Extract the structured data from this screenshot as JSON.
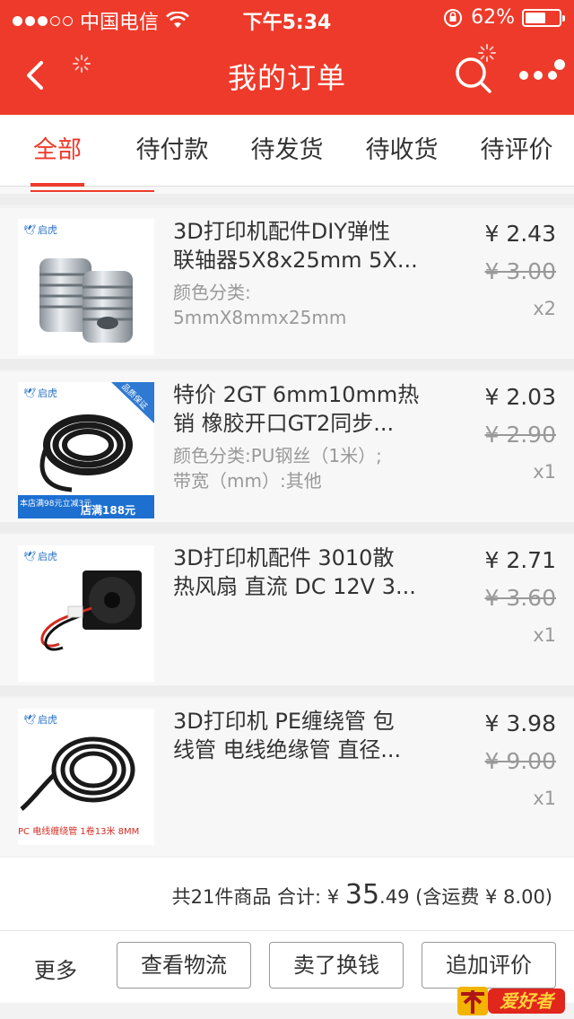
{
  "status": {
    "carrier": "中国电信",
    "time": "下午5:34",
    "battery_pct": "62%",
    "battery_level": 0.62,
    "signal_dots_filled": 3
  },
  "nav": {
    "title": "我的订单"
  },
  "tabs": [
    {
      "label": "全部",
      "active": true
    },
    {
      "label": "待付款",
      "active": false
    },
    {
      "label": "待发货",
      "active": false
    },
    {
      "label": "待收货",
      "active": false
    },
    {
      "label": "待评价",
      "active": false
    }
  ],
  "items": [
    {
      "brand": "启虎",
      "name_lines": [
        "3D打印机配件DIY弹性",
        "联轴器5X8x25mm 5X..."
      ],
      "spec_lines": [
        "颜色分类:",
        "5mmX8mmx25mm"
      ],
      "price": "¥ 2.43",
      "original_price": "¥ 3.00",
      "qty": "x2"
    },
    {
      "brand": "启虎",
      "name_lines": [
        "特价 2GT 6mm10mm热",
        "销 橡胶开口GT2同步..."
      ],
      "spec_lines": [
        "颜色分类:PU钢丝（1米）;",
        "带宽（mm）:其他"
      ],
      "price": "¥ 2.03",
      "original_price": "¥ 2.90",
      "qty": "x1",
      "badge_text": "店满188元",
      "promo_text": "本店满98元立减3元",
      "ribbon_text": "品质保证"
    },
    {
      "brand": "启虎",
      "name_lines": [
        "3D打印机配件 3010散",
        "热风扇 直流 DC 12V 3..."
      ],
      "spec_lines": [],
      "price": "¥ 2.71",
      "original_price": "¥ 3.60",
      "qty": "x1"
    },
    {
      "brand": "启虎",
      "name_lines": [
        "3D打印机 PE缠绕管 包",
        "线管 电线绝缘管 直径..."
      ],
      "spec_lines": [],
      "price": "¥ 3.98",
      "original_price": "¥ 9.00",
      "qty": "x1",
      "caption": "PC 电线缠绕管 1卷13米 8MM"
    }
  ],
  "summary": {
    "count_text": "共21件商品",
    "total_label": "合计:",
    "currency": "¥",
    "total_int": "35",
    "total_dec": ".49",
    "shipping": "(含运费 ¥ 8.00)"
  },
  "actions": {
    "more": "更多",
    "logistics": "查看物流",
    "resell": "卖了换钱",
    "add_review": "追加评价"
  },
  "watermark": "爱好者",
  "colors": {
    "brand_red": "#ee3a2a",
    "text": "#333333",
    "muted": "#999999"
  },
  "icons": [
    "back-icon",
    "search-icon",
    "more-icon",
    "wifi-icon",
    "lock-rotation-icon",
    "battery-icon",
    "loading-spinner-icon"
  ]
}
